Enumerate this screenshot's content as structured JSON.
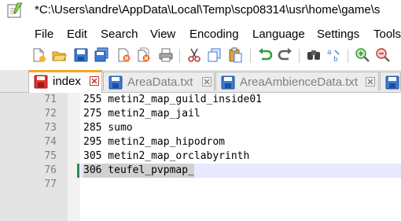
{
  "window": {
    "title": "*C:\\Users\\andre\\AppData\\Local\\Temp\\scp08314\\usr\\home\\game\\s"
  },
  "menu": {
    "items": [
      "File",
      "Edit",
      "Search",
      "View",
      "Encoding",
      "Language",
      "Settings",
      "Tools"
    ]
  },
  "toolbar": {
    "buttons": [
      "new-file",
      "open-file",
      "save",
      "save-all",
      "close",
      "close-all",
      "print",
      "cut",
      "copy",
      "paste",
      "undo",
      "redo",
      "find",
      "replace",
      "zoom-in",
      "zoom-out"
    ]
  },
  "tabs": [
    {
      "label": "index",
      "active": true,
      "modified": true
    },
    {
      "label": "AreaData.txt",
      "active": false,
      "modified": false
    },
    {
      "label": "AreaAmbienceData.txt",
      "active": false,
      "modified": false
    }
  ],
  "editor": {
    "lines": [
      {
        "num": "71",
        "text": "255 metin2_map_guild_inside01"
      },
      {
        "num": "72",
        "text": "275 metin2_map_jail"
      },
      {
        "num": "73",
        "text": "285 sumo"
      },
      {
        "num": "74",
        "text": "295 metin2_map_hipodrom"
      },
      {
        "num": "75",
        "text": "305 metin2_map_orclabyrinth"
      },
      {
        "num": "76",
        "text": "306 teufel_pvpmap_"
      },
      {
        "num": "77",
        "text": ""
      }
    ],
    "current_line": "76"
  },
  "colors": {
    "active_tab_accent": "#f5a623",
    "modified_icon": "#e03030",
    "saved_icon": "#3a7bd5",
    "gutter_bg": "#e4e4e4",
    "current_line_bg": "#e8e8ff"
  }
}
